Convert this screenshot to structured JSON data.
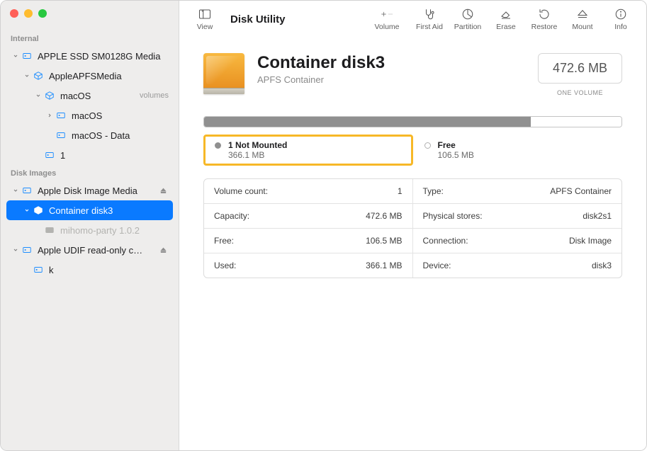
{
  "app_title": "Disk Utility",
  "toolbar": {
    "view": "View",
    "volume": "Volume",
    "first_aid": "First Aid",
    "partition": "Partition",
    "erase": "Erase",
    "restore": "Restore",
    "mount": "Mount",
    "info": "Info"
  },
  "sidebar": {
    "sections": [
      {
        "header": "Internal",
        "items": [
          {
            "label": "APPLE SSD SM0128G Media",
            "indent": 0,
            "icon": "disk",
            "chevron": "down"
          },
          {
            "label": "AppleAPFSMedia",
            "indent": 1,
            "icon": "container",
            "chevron": "down"
          },
          {
            "label": "macOS",
            "sublabel": "volumes",
            "indent": 2,
            "icon": "container",
            "chevron": "down"
          },
          {
            "label": "macOS",
            "indent": 3,
            "icon": "volume",
            "chevron": "right"
          },
          {
            "label": "macOS - Data",
            "indent": 3,
            "icon": "volume"
          },
          {
            "label": "1",
            "indent": 2,
            "icon": "volume"
          }
        ]
      },
      {
        "header": "Disk Images",
        "items": [
          {
            "label": "Apple Disk Image Media",
            "indent": 0,
            "icon": "disk",
            "chevron": "down",
            "eject": true
          },
          {
            "label": "Container disk3",
            "indent": 1,
            "icon": "container",
            "chevron": "down",
            "selected": true
          },
          {
            "label": "mihomo-party 1.0.2",
            "indent": 2,
            "icon": "volume",
            "dimmed": true
          },
          {
            "label": "Apple UDIF read-only c…",
            "indent": 0,
            "icon": "disk",
            "chevron": "down",
            "eject": true
          },
          {
            "label": "k",
            "indent": 1,
            "icon": "volume"
          }
        ]
      }
    ]
  },
  "header": {
    "title": "Container disk3",
    "subtitle": "APFS Container",
    "capacity": "472.6 MB",
    "capacity_sub": "ONE VOLUME"
  },
  "usage": {
    "used_pct": 78.2
  },
  "legend": {
    "used": {
      "label": "1 Not Mounted",
      "value": "366.1 MB"
    },
    "free": {
      "label": "Free",
      "value": "106.5 MB"
    }
  },
  "details": [
    {
      "key": "Volume count:",
      "val": "1"
    },
    {
      "key": "Type:",
      "val": "APFS Container"
    },
    {
      "key": "Capacity:",
      "val": "472.6 MB"
    },
    {
      "key": "Physical stores:",
      "val": "disk2s1"
    },
    {
      "key": "Free:",
      "val": "106.5 MB"
    },
    {
      "key": "Connection:",
      "val": "Disk Image"
    },
    {
      "key": "Used:",
      "val": "366.1 MB"
    },
    {
      "key": "Device:",
      "val": "disk3"
    }
  ]
}
